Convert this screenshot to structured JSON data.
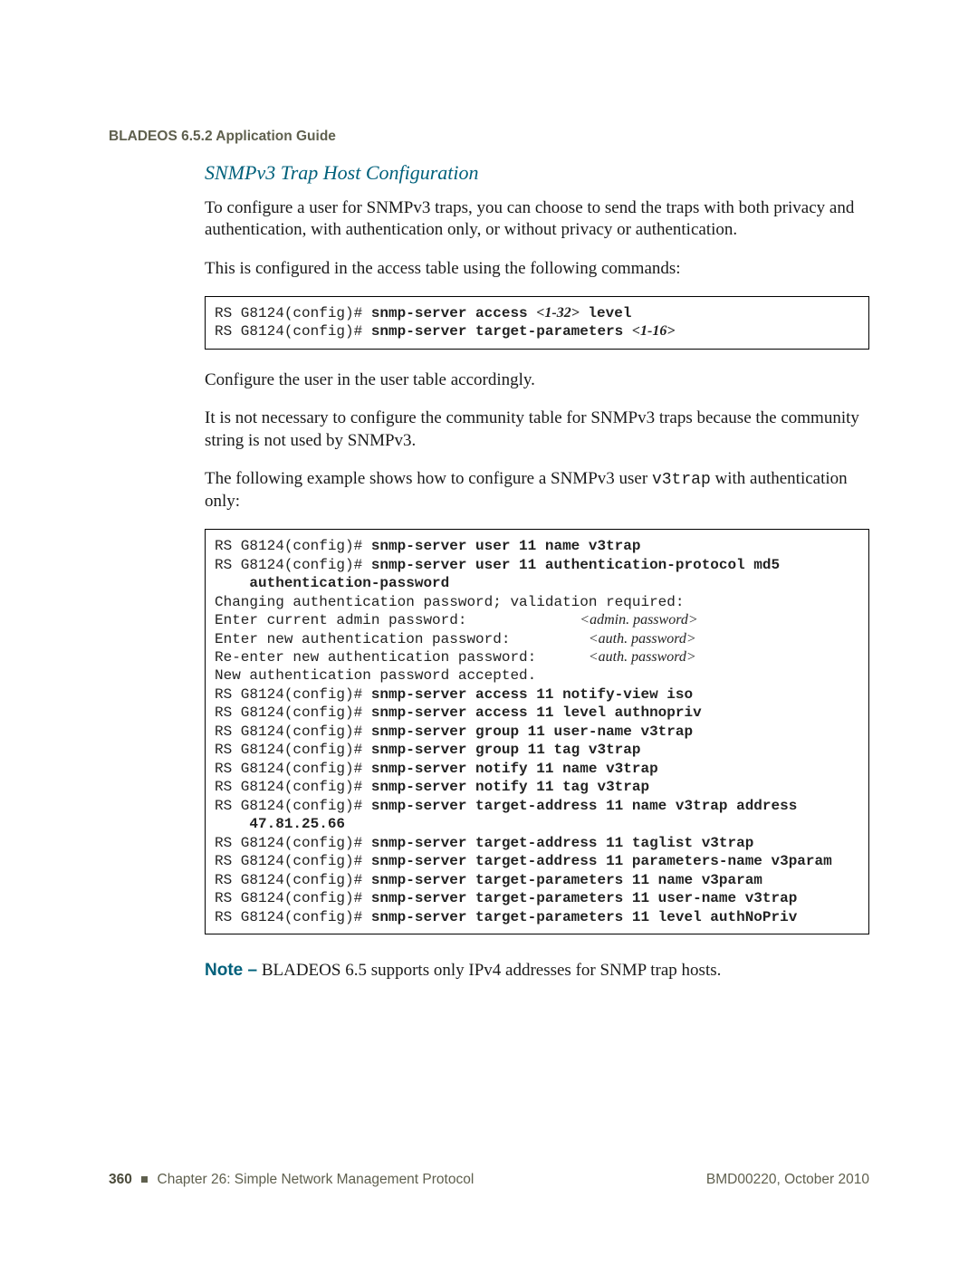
{
  "header": {
    "guide": "BLADEOS 6.5.2 Application Guide"
  },
  "section": {
    "title": "SNMPv3 Trap Host Configuration"
  },
  "paras": {
    "p1": "To configure a user for SNMPv3 traps, you can choose to send the traps with both privacy and authentication, with authentication only, or without privacy or authentication.",
    "p2": "This is configured in the access table using the following commands:",
    "p3": "Configure the user in the user table accordingly.",
    "p4": "It is not necessary to configure the community table for SNMPv3 traps because the community string is not used by SNMPv3.",
    "p5_a": "The following example shows how to configure a SNMPv3 user ",
    "p5_code": "v3trap",
    "p5_b": " with authentication only:"
  },
  "code1": {
    "l1_prompt": "RS G8124(config)# ",
    "l1_cmd_a": "snmp-server access ",
    "l1_arg": "<1-32>",
    "l1_cmd_b": " level",
    "l2_prompt": "RS G8124(config)# ",
    "l2_cmd": "snmp-server target-parameters ",
    "l2_arg": "<1-16>"
  },
  "code2": {
    "p": "RS G8124(config)# ",
    "c01": "snmp-server user 11 name v3trap",
    "c02a": "snmp-server user 11 authentication-protocol md5",
    "c02b": "authentication-password",
    "t03": "Changing authentication password; validation required:",
    "t04a": "Enter current admin password:             ",
    "t04b": "<admin. password>",
    "t05a": "Enter new authentication password:         ",
    "t05b": "<auth. password>",
    "t06a": "Re-enter new authentication password:      ",
    "t06b": "<auth. password>",
    "t07": "New authentication password accepted.",
    "c08": "snmp-server access 11 notify-view iso",
    "c09": "snmp-server access 11 level authnopriv",
    "c10": "snmp-server group 11 user-name v3trap",
    "c11": "snmp-server group 11 tag v3trap",
    "c12": "snmp-server notify 11 name v3trap",
    "c13": "snmp-server notify 11 tag v3trap",
    "c14a": "snmp-server target-address 11 name v3trap address",
    "c14b": "47.81.25.66",
    "c15": "snmp-server target-address 11 taglist v3trap",
    "c16": "snmp-server target-address 11 parameters-name v3param",
    "c17": "snmp-server target-parameters 11 name v3param",
    "c18": "snmp-server target-parameters 11 user-name v3trap",
    "c19": "snmp-server target-parameters 11 level authNoPriv"
  },
  "note": {
    "label": "Note –",
    "text": " BLADEOS 6.5 supports only IPv4 addresses for SNMP trap hosts."
  },
  "footer": {
    "page": "360",
    "chapter": "Chapter 26: Simple Network Management Protocol",
    "right": "BMD00220, October 2010"
  }
}
